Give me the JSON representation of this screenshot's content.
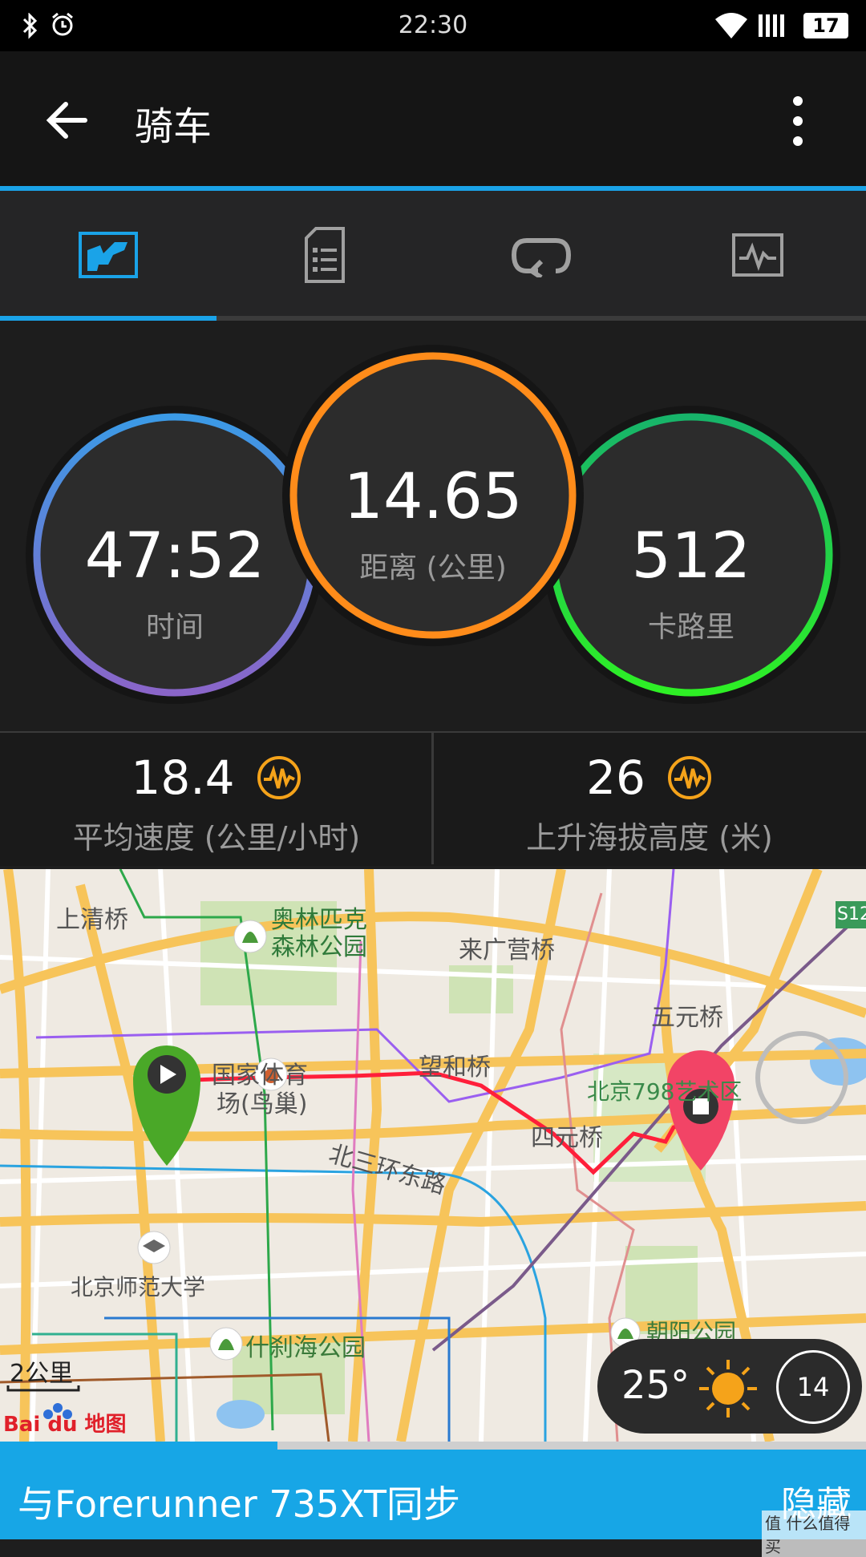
{
  "status_bar": {
    "time": "22:30",
    "battery": "17"
  },
  "app_bar": {
    "title": "骑车"
  },
  "tabs": [
    {
      "icon": "chart-icon",
      "selected": true
    },
    {
      "icon": "document-list-icon",
      "selected": false
    },
    {
      "icon": "loop-arrow-icon",
      "selected": false
    },
    {
      "icon": "heartrate-chart-icon",
      "selected": false
    }
  ],
  "rings": {
    "time": {
      "value": "47:52",
      "label": "时间"
    },
    "distance": {
      "value": "14.65",
      "label": "距离 (公里)"
    },
    "calories": {
      "value": "512",
      "label": "卡路里"
    }
  },
  "metrics": {
    "avg_speed": {
      "value": "18.4",
      "label": "平均速度 (公里/小时)"
    },
    "elev_gain": {
      "value": "26",
      "label": "上升海拔高度 (米)"
    }
  },
  "map": {
    "labels": {
      "shangqing": "上清桥",
      "olympic1": "奥林匹克",
      "olympic2": "森林公园",
      "laiguangying": "来广营桥",
      "wuyuan": "五元桥",
      "stadium1": "国家体育",
      "stadium2": "场(鸟巢)",
      "wanghe": "望和桥",
      "b798": "北京798艺术区",
      "north3ring": "北三环东路",
      "siyuan": "四元桥",
      "bnu": "北京师范大学",
      "shichahai": "什刹海公园",
      "chaoyang": "朝阳公园",
      "s12": "S12"
    },
    "scale": "2公里",
    "logo": "Bai du 地图"
  },
  "weather": {
    "temp": "25°",
    "wind": "14"
  },
  "sync": {
    "text": "与Forerunner 735XT同步",
    "hide": "隐藏",
    "progress": 0.32
  },
  "watermark": "值 什么值得买",
  "colors": {
    "accent": "#1aa3e8",
    "time_ring": "#4a7fd6",
    "distance_ring": "#ff8c1a",
    "calorie_ring": "#1fd35a",
    "route": "#ff1f3a"
  }
}
